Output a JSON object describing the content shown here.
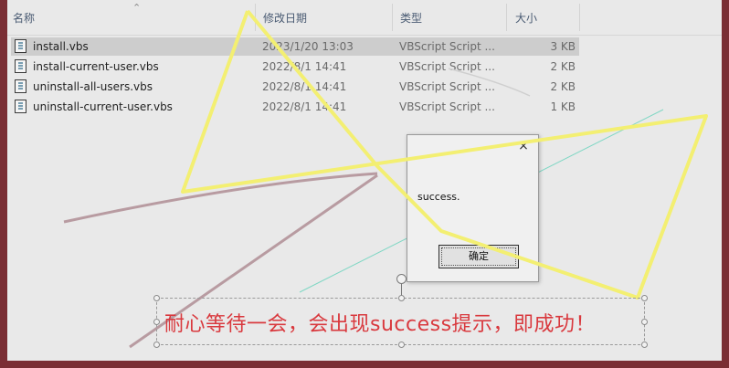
{
  "columns": {
    "name": "名称",
    "date": "修改日期",
    "type": "类型",
    "size": "大小"
  },
  "files": [
    {
      "name": "install.vbs",
      "date": "2023/1/20 13:03",
      "type": "VBScript Script ...",
      "size": "3 KB",
      "selected": true
    },
    {
      "name": "install-current-user.vbs",
      "date": "2022/8/1 14:41",
      "type": "VBScript Script ...",
      "size": "2 KB",
      "selected": false
    },
    {
      "name": "uninstall-all-users.vbs",
      "date": "2022/8/1 14:41",
      "type": "VBScript Script ...",
      "size": "2 KB",
      "selected": false
    },
    {
      "name": "uninstall-current-user.vbs",
      "date": "2022/8/1 14:41",
      "type": "VBScript Script ...",
      "size": "1 KB",
      "selected": false
    }
  ],
  "file_icon": "vbscript-file-icon",
  "dialog": {
    "close_glyph": "×",
    "message": "success.",
    "ok_label": "确定"
  },
  "annotation": {
    "text": "耐心等待一会，会出现success提示，即成功！",
    "color": "#d9393e"
  },
  "colors": {
    "highlight_box": "#d23a3a",
    "scribble_yellow": "#f3ef72",
    "selection": "#cdcdcd"
  }
}
